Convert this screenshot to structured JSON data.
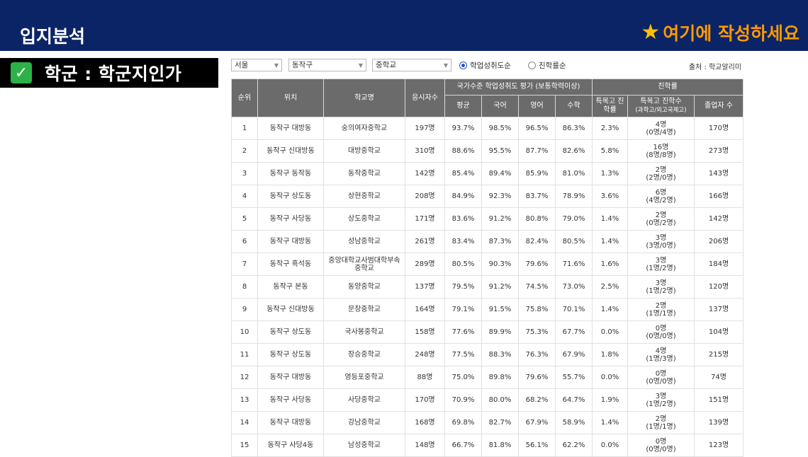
{
  "header": {
    "title": "입지분석",
    "note": "여기에 작성하세요",
    "note_icon": "star-icon"
  },
  "topic": {
    "check_icon": "checkmark-icon",
    "label": "학군 : 학군지인가"
  },
  "filters": {
    "city": "서울",
    "district": "동작구",
    "level": "중학교",
    "radio_1": "학업성취도순",
    "radio_2": "진학률순",
    "selected_radio": "학업성취도순",
    "source": "출처 : 학교알리미"
  },
  "table": {
    "headers": {
      "rank": "순위",
      "location": "위치",
      "school": "학교명",
      "examinees": "응시자수",
      "national_group": "국가수준 학업성취도 평가 (보통학력이상)",
      "avg": "평균",
      "korean": "국어",
      "english": "영어",
      "math": "수학",
      "advancement": "진학률",
      "special_rate": "특목고 진학률",
      "special_count": "특목고 진학수",
      "special_count_sub": "(과학고/외고국제고)",
      "graduates": "졸업자 수"
    },
    "rows": [
      {
        "rank": "1",
        "location": "동작구 대방동",
        "school": "숭의여자중학교",
        "examinees": "197명",
        "avg": "93.7%",
        "korean": "98.5%",
        "english": "96.5%",
        "math": "86.3%",
        "rate": "2.3%",
        "count": "4명",
        "count_sub": "(0명/4명)",
        "graduates": "170명"
      },
      {
        "rank": "2",
        "location": "동작구 신대방동",
        "school": "대방중학교",
        "examinees": "310명",
        "avg": "88.6%",
        "korean": "95.5%",
        "english": "87.7%",
        "math": "82.6%",
        "rate": "5.8%",
        "count": "16명",
        "count_sub": "(8명/8명)",
        "graduates": "273명"
      },
      {
        "rank": "3",
        "location": "동작구 동작동",
        "school": "동작중학교",
        "examinees": "142명",
        "avg": "85.4%",
        "korean": "89.4%",
        "english": "85.9%",
        "math": "81.0%",
        "rate": "1.3%",
        "count": "2명",
        "count_sub": "(2명/0명)",
        "graduates": "143명"
      },
      {
        "rank": "4",
        "location": "동작구 상도동",
        "school": "상현중학교",
        "examinees": "208명",
        "avg": "84.9%",
        "korean": "92.3%",
        "english": "83.7%",
        "math": "78.9%",
        "rate": "3.6%",
        "count": "6명",
        "count_sub": "(4명/2명)",
        "graduates": "166명"
      },
      {
        "rank": "5",
        "location": "동작구 사당동",
        "school": "상도중학교",
        "examinees": "171명",
        "avg": "83.6%",
        "korean": "91.2%",
        "english": "80.8%",
        "math": "79.0%",
        "rate": "1.4%",
        "count": "2명",
        "count_sub": "(0명/2명)",
        "graduates": "142명"
      },
      {
        "rank": "6",
        "location": "동작구 대방동",
        "school": "성남중학교",
        "examinees": "261명",
        "avg": "83.4%",
        "korean": "87.3%",
        "english": "82.4%",
        "math": "80.5%",
        "rate": "1.4%",
        "count": "3명",
        "count_sub": "(3명/0명)",
        "graduates": "206명"
      },
      {
        "rank": "7",
        "location": "동작구 흑석동",
        "school": "중앙대학교사범대학부속중학교",
        "examinees": "289명",
        "avg": "80.5%",
        "korean": "90.3%",
        "english": "79.6%",
        "math": "71.6%",
        "rate": "1.6%",
        "count": "3명",
        "count_sub": "(1명/2명)",
        "graduates": "184명"
      },
      {
        "rank": "8",
        "location": "동작구 본동",
        "school": "동양중학교",
        "examinees": "137명",
        "avg": "79.5%",
        "korean": "91.2%",
        "english": "74.5%",
        "math": "73.0%",
        "rate": "2.5%",
        "count": "3명",
        "count_sub": "(1명/2명)",
        "graduates": "120명"
      },
      {
        "rank": "9",
        "location": "동작구 신대방동",
        "school": "문창중학교",
        "examinees": "164명",
        "avg": "79.1%",
        "korean": "91.5%",
        "english": "75.8%",
        "math": "70.1%",
        "rate": "1.4%",
        "count": "2명",
        "count_sub": "(1명/1명)",
        "graduates": "137명"
      },
      {
        "rank": "10",
        "location": "동작구 상도동",
        "school": "국사봉중학교",
        "examinees": "158명",
        "avg": "77.6%",
        "korean": "89.9%",
        "english": "75.3%",
        "math": "67.7%",
        "rate": "0.0%",
        "count": "0명",
        "count_sub": "(0명/0명)",
        "graduates": "104명"
      },
      {
        "rank": "11",
        "location": "동작구 상도동",
        "school": "장승중학교",
        "examinees": "248명",
        "avg": "77.5%",
        "korean": "88.3%",
        "english": "76.3%",
        "math": "67.9%",
        "rate": "1.8%",
        "count": "4명",
        "count_sub": "(1명/3명)",
        "graduates": "215명"
      },
      {
        "rank": "12",
        "location": "동작구 대방동",
        "school": "영등포중학교",
        "examinees": "88명",
        "avg": "75.0%",
        "korean": "89.8%",
        "english": "79.6%",
        "math": "55.7%",
        "rate": "0.0%",
        "count": "0명",
        "count_sub": "(0명/0명)",
        "graduates": "74명"
      },
      {
        "rank": "13",
        "location": "동작구 사당동",
        "school": "사당중학교",
        "examinees": "170명",
        "avg": "70.9%",
        "korean": "80.0%",
        "english": "68.2%",
        "math": "64.7%",
        "rate": "1.9%",
        "count": "3명",
        "count_sub": "(1명/2명)",
        "graduates": "151명"
      },
      {
        "rank": "14",
        "location": "동작구 대방동",
        "school": "강남중학교",
        "examinees": "168명",
        "avg": "69.8%",
        "korean": "82.7%",
        "english": "67.9%",
        "math": "58.9%",
        "rate": "1.4%",
        "count": "2명",
        "count_sub": "(1명/1명)",
        "graduates": "139명"
      },
      {
        "rank": "15",
        "location": "동작구 사당4동",
        "school": "남성중학교",
        "examinees": "148명",
        "avg": "66.7%",
        "korean": "81.8%",
        "english": "56.1%",
        "math": "62.2%",
        "rate": "0.0%",
        "count": "0명",
        "count_sub": "(0명/0명)",
        "graduates": "123명"
      }
    ]
  }
}
